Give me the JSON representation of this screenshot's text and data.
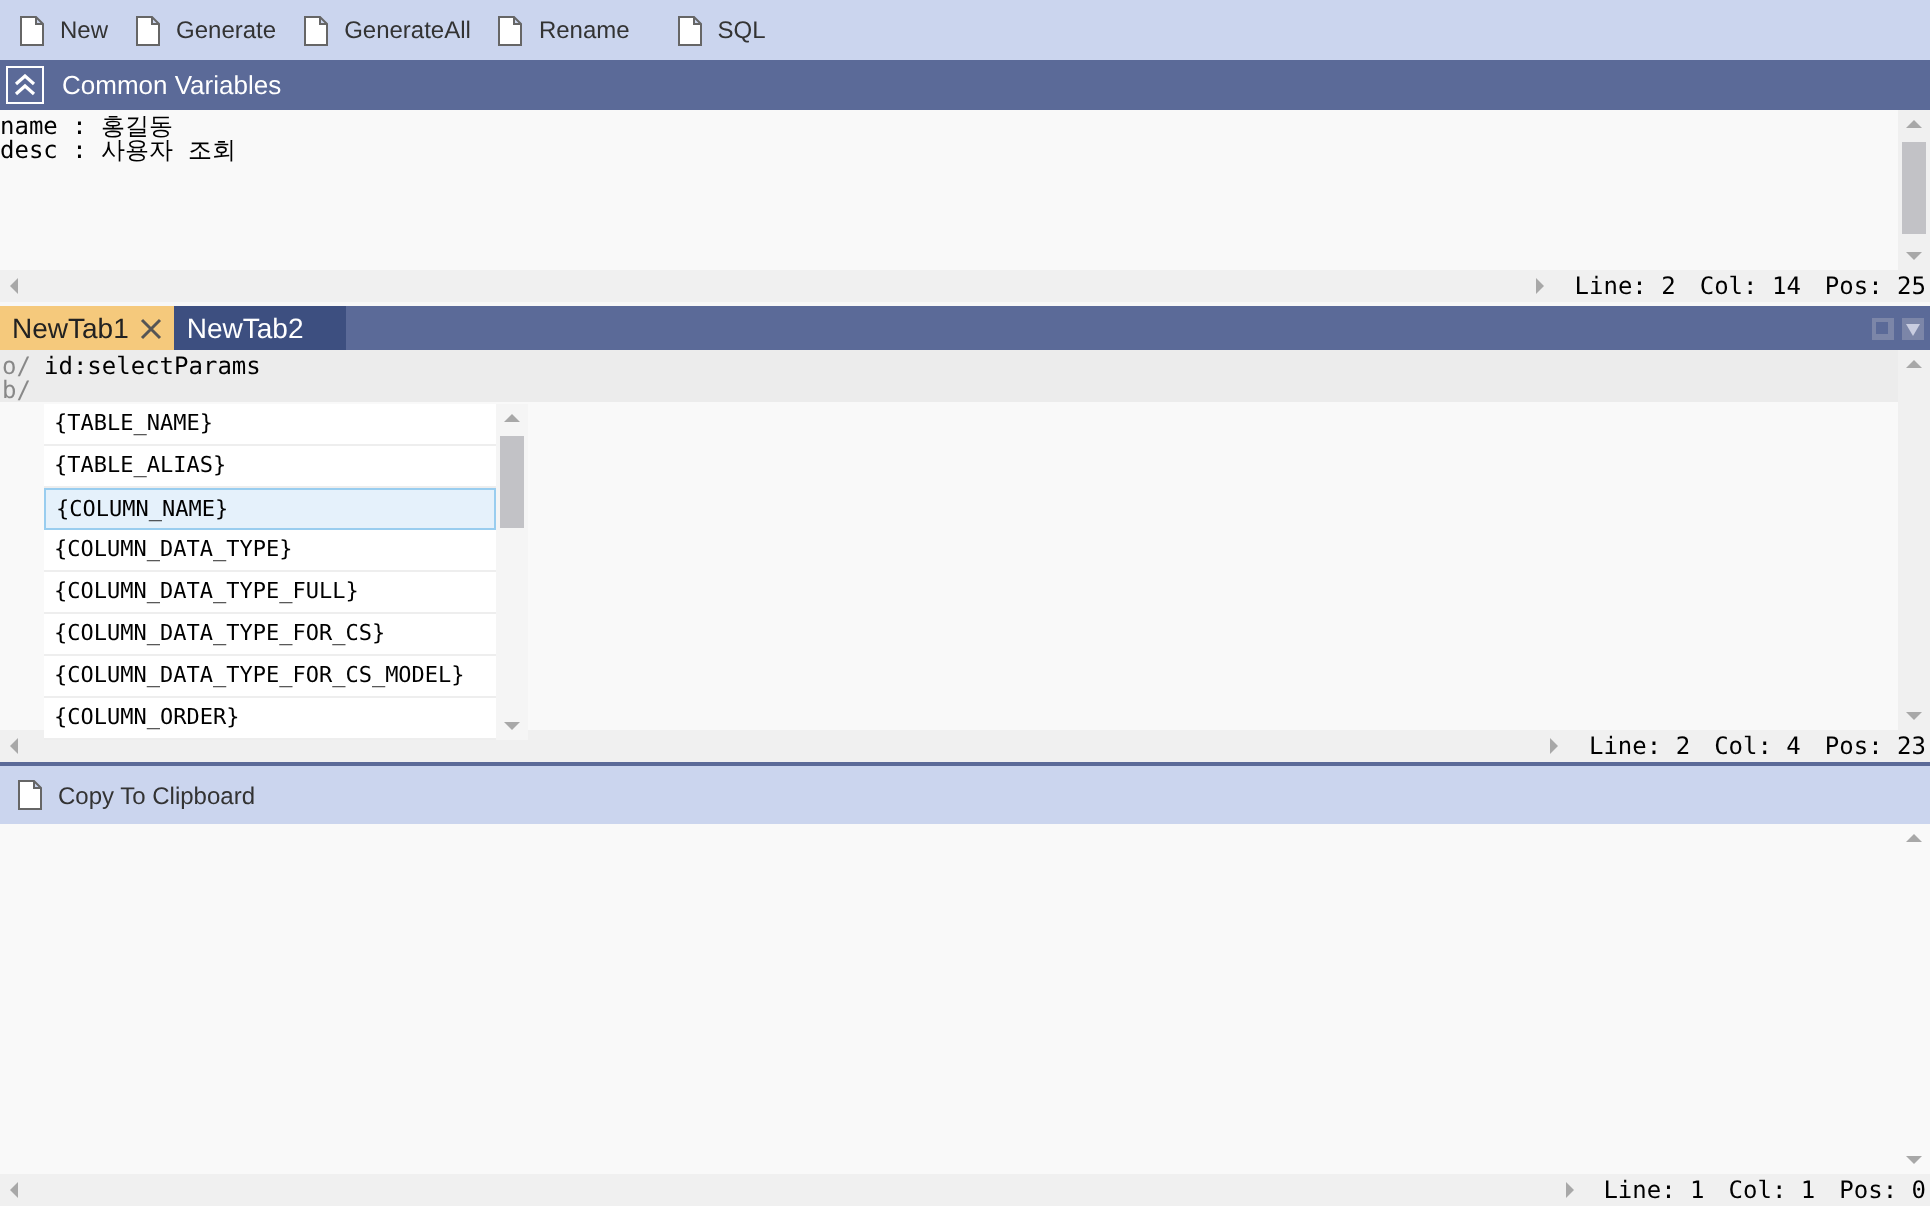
{
  "toolbar": [
    {
      "label": "New"
    },
    {
      "label": "Generate"
    },
    {
      "label": "GenerateAll"
    },
    {
      "label": "Rename"
    },
    {
      "label": "SQL"
    }
  ],
  "common_variables": {
    "title": "Common Variables",
    "expanded": true,
    "lines": [
      "name : 홍길동",
      "desc : 사용자 조회"
    ],
    "status": [
      "Line: 2",
      "Col: 14",
      "Pos: 25"
    ]
  },
  "tabs": [
    {
      "label": "NewTab1",
      "selected": true
    },
    {
      "label": "NewTab2",
      "selected": false
    }
  ],
  "editor": {
    "lines": [
      {
        "marker": "o/",
        "text": "id:selectParams"
      },
      {
        "marker": "b/"
      }
    ],
    "autocomplete": [
      {
        "label": "{TABLE_NAME}",
        "selected": false
      },
      {
        "label": "{TABLE_ALIAS}",
        "selected": false
      },
      {
        "label": "{COLUMN_NAME}",
        "selected": true
      },
      {
        "label": "{COLUMN_DATA_TYPE}",
        "selected": false
      },
      {
        "label": "{COLUMN_DATA_TYPE_FULL}",
        "selected": false
      },
      {
        "label": "{COLUMN_DATA_TYPE_FOR_CS}",
        "selected": false
      },
      {
        "label": "{COLUMN_DATA_TYPE_FOR_CS_MODEL}",
        "selected": false
      },
      {
        "label": "{COLUMN_ORDER}",
        "selected": false
      }
    ],
    "status": [
      "Line: 2",
      "Col: 4",
      "Pos: 23"
    ]
  },
  "output": {
    "button": "Copy To Clipboard",
    "status": [
      "Line: 1",
      "Col: 1",
      "Pos: 0"
    ]
  }
}
